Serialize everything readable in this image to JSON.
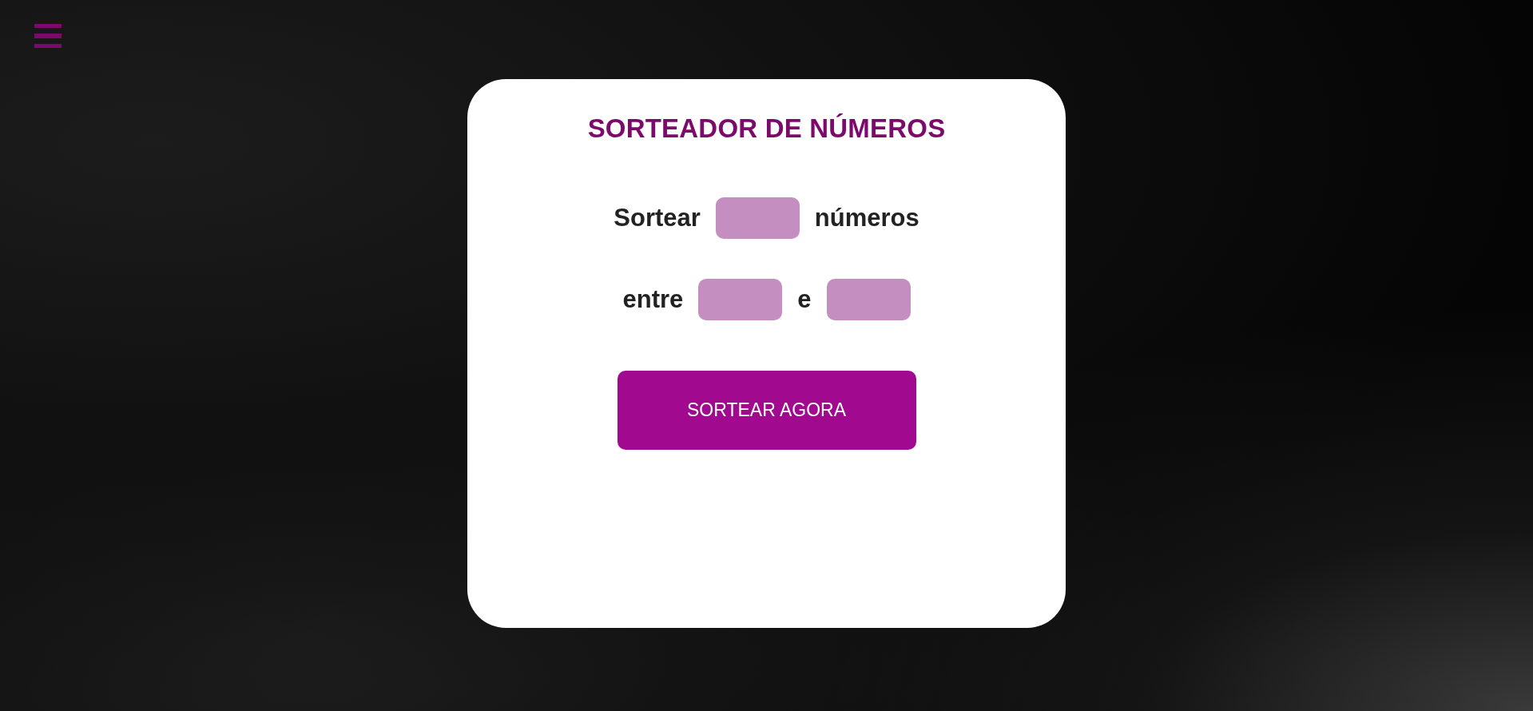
{
  "title": "SORTEADOR DE NÚMEROS",
  "rows": [
    {
      "parts": [
        {
          "kind": "text",
          "text": "Sortear"
        },
        {
          "kind": "field"
        },
        {
          "kind": "text",
          "text": "números"
        }
      ]
    },
    {
      "parts": [
        {
          "kind": "text",
          "text": "entre"
        },
        {
          "kind": "field"
        },
        {
          "kind": "text",
          "text": "e"
        },
        {
          "kind": "field"
        }
      ]
    }
  ],
  "button": {
    "label": "SORTEAR AGORA"
  }
}
